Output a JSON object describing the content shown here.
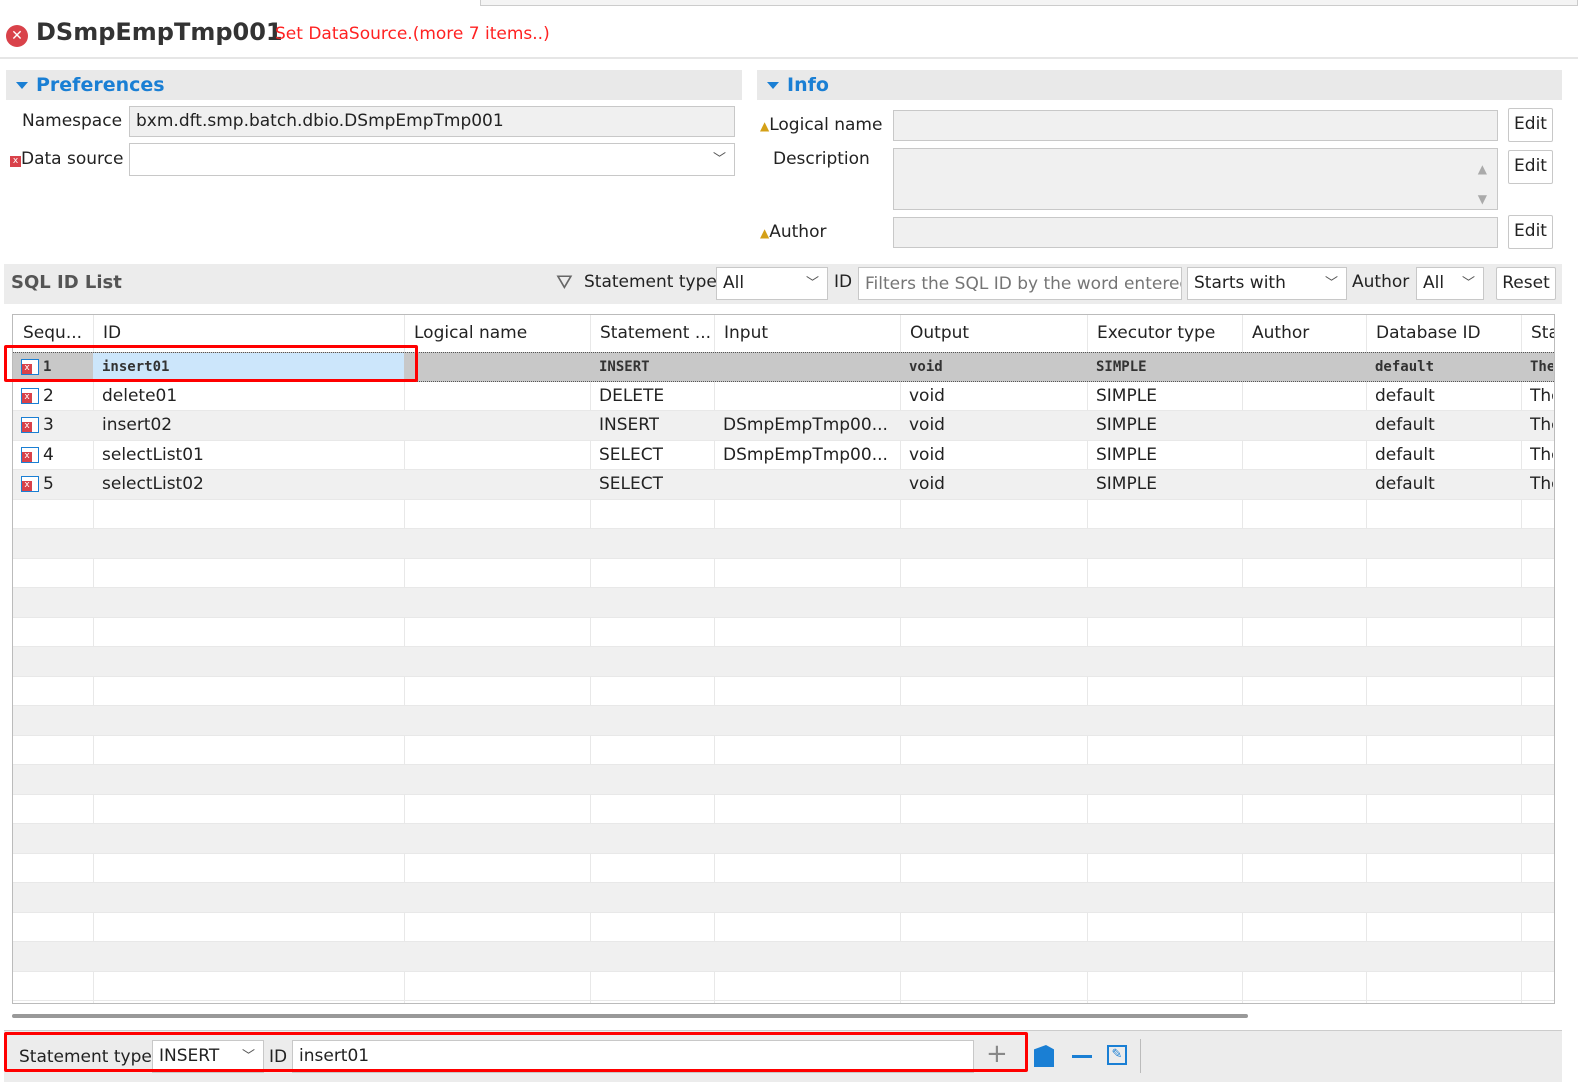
{
  "header": {
    "title": "DSmpEmpTmp001",
    "message": "Set DataSource.(more 7 items..)",
    "status_icon": "error-icon"
  },
  "preferences": {
    "title": "Preferences",
    "namespace_label": "Namespace",
    "namespace_value": "bxm.dft.smp.batch.dbio.DSmpEmpTmp001",
    "datasource_label": "Data source",
    "datasource_value": ""
  },
  "info": {
    "title": "Info",
    "logical_name_label": "Logical name",
    "logical_name_value": "",
    "description_label": "Description",
    "description_value": "",
    "author_label": "Author",
    "author_value": "",
    "edit_label": "Edit"
  },
  "toolbar": {
    "title": "SQL ID List",
    "statement_type_label": "Statement type",
    "statement_type_value": "All",
    "id_label": "ID",
    "id_placeholder": "Filters the SQL ID by the word entered",
    "match_value": "Starts with",
    "author_label": "Author",
    "author_value": "All",
    "reset_label": "Reset"
  },
  "table": {
    "columns": [
      "Sequ...",
      "ID",
      "Logical name",
      "Statement ...",
      "Input",
      "Output",
      "Executor type",
      "Author",
      "Database ID",
      "Sta"
    ],
    "rows": [
      [
        "1",
        "insert01",
        "",
        "INSERT",
        "",
        "void",
        "SIMPLE",
        "",
        "default",
        "The"
      ],
      [
        "2",
        "delete01",
        "",
        "DELETE",
        "",
        "void",
        "SIMPLE",
        "",
        "default",
        "The"
      ],
      [
        "3",
        "insert02",
        "",
        "INSERT",
        "DSmpEmpTmp00...",
        "void",
        "SIMPLE",
        "",
        "default",
        "The"
      ],
      [
        "4",
        "selectList01",
        "",
        "SELECT",
        "DSmpEmpTmp00...",
        "void",
        "SIMPLE",
        "",
        "default",
        "The"
      ],
      [
        "5",
        "selectList02",
        "",
        "SELECT",
        "",
        "void",
        "SIMPLE",
        "",
        "default",
        "The"
      ]
    ],
    "selected_row": 0
  },
  "bottom": {
    "statement_type_label": "Statement type",
    "statement_type_value": "INSERT",
    "id_label": "ID",
    "id_value": "insert01"
  },
  "colors": {
    "accent": "#1a7fd4",
    "error": "#ff2222",
    "highlight": "#ff0000"
  }
}
